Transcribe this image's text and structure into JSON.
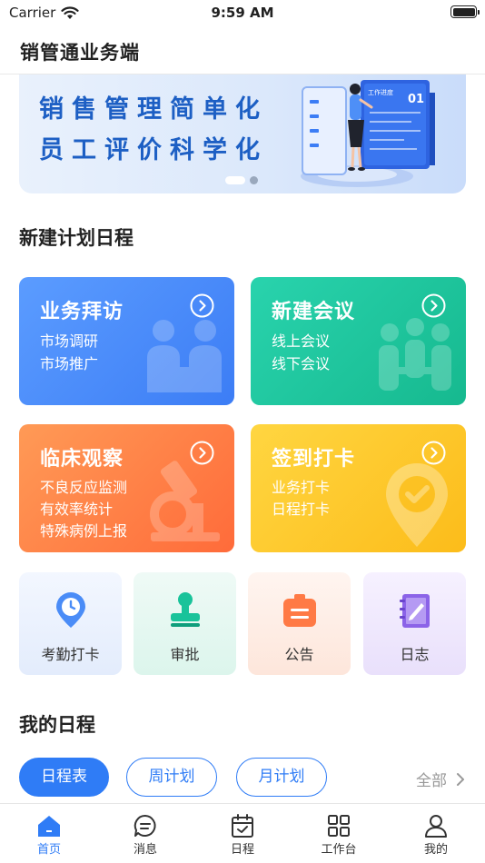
{
  "status": {
    "carrier": "Carrier",
    "time": "9:59 AM"
  },
  "nav": {
    "title": "销管通业务端"
  },
  "banner": {
    "line1": "销售管理简单化",
    "line2": "员工评价科学化",
    "board_label": "工作进度",
    "board_number": "01",
    "slide_count": 2,
    "active_slide": 1
  },
  "sections": {
    "plan": "新建计划日程",
    "schedule": "我的日程"
  },
  "cards": [
    {
      "title": "业务拜访",
      "subs": [
        "市场调研",
        "市场推广"
      ],
      "color": "#3c7df5"
    },
    {
      "title": "新建会议",
      "subs": [
        "线上会议",
        "线下会议"
      ],
      "color": "#16b98f"
    },
    {
      "title": "临床观察",
      "subs": [
        "不良反应监测",
        "有效率统计",
        "特殊病例上报"
      ],
      "color": "#ff6b3a"
    },
    {
      "title": "签到打卡",
      "subs": [
        "业务打卡",
        "日程打卡"
      ],
      "color": "#fcbc1a"
    }
  ],
  "tiles": [
    {
      "label": "考勤打卡",
      "icon": "location-clock-icon"
    },
    {
      "label": "审批",
      "icon": "stamp-icon"
    },
    {
      "label": "公告",
      "icon": "announcement-icon"
    },
    {
      "label": "日志",
      "icon": "notebook-icon"
    }
  ],
  "schedule_tabs": [
    {
      "label": "日程表",
      "active": true
    },
    {
      "label": "周计划",
      "active": false
    },
    {
      "label": "月计划",
      "active": false
    }
  ],
  "all_link": "全部",
  "tab_bar": [
    {
      "label": "首页",
      "icon": "home-icon",
      "active": true
    },
    {
      "label": "消息",
      "icon": "message-icon",
      "active": false
    },
    {
      "label": "日程",
      "icon": "calendar-icon",
      "active": false
    },
    {
      "label": "工作台",
      "icon": "grid-icon",
      "active": false
    },
    {
      "label": "我的",
      "icon": "profile-icon",
      "active": false
    }
  ],
  "colors": {
    "accent": "#2f7cf6",
    "banner_text": "#1d5fc4"
  }
}
